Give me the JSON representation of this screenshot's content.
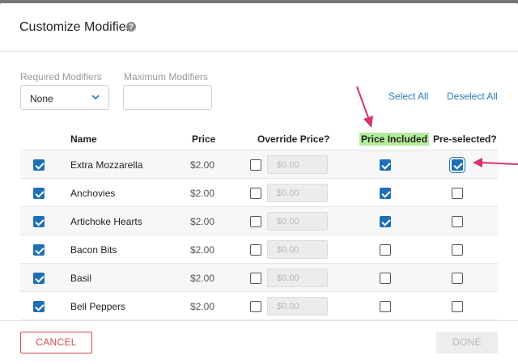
{
  "modal": {
    "title": "Customize Modifier",
    "help_icon": "question-circle-icon"
  },
  "fields": {
    "required_label": "Required Modifiers",
    "required_value": "None",
    "maximum_label": "Maximum Modifiers",
    "maximum_value": ""
  },
  "links": {
    "select_all": "Select All",
    "deselect_all": "Deselect All"
  },
  "table": {
    "headers": {
      "name": "Name",
      "price": "Price",
      "override": "Override Price?",
      "price_included": "Price Included",
      "preselected": "Pre-selected?"
    },
    "override_placeholder": "$0.00",
    "rows": [
      {
        "name": "Extra Mozzarella",
        "price": "$2.00",
        "selected": true,
        "override": false,
        "price_included": true,
        "preselected": true
      },
      {
        "name": "Anchovies",
        "price": "$2.00",
        "selected": true,
        "override": false,
        "price_included": true,
        "preselected": false
      },
      {
        "name": "Artichoke Hearts",
        "price": "$2.00",
        "selected": true,
        "override": false,
        "price_included": true,
        "preselected": false
      },
      {
        "name": "Bacon Bits",
        "price": "$2.00",
        "selected": true,
        "override": false,
        "price_included": false,
        "preselected": false
      },
      {
        "name": "Basil",
        "price": "$2.00",
        "selected": true,
        "override": false,
        "price_included": false,
        "preselected": false
      },
      {
        "name": "Bell Peppers",
        "price": "$2.00",
        "selected": true,
        "override": false,
        "price_included": false,
        "preselected": false
      }
    ]
  },
  "footer": {
    "cancel_label": "CANCEL",
    "done_label": "DONE"
  },
  "colors": {
    "accent": "#1e6fb7",
    "link": "#2a7ab8",
    "cancel": "#e04848",
    "highlight": "#b5ec9c",
    "annotation_arrow": "#d6336c"
  }
}
